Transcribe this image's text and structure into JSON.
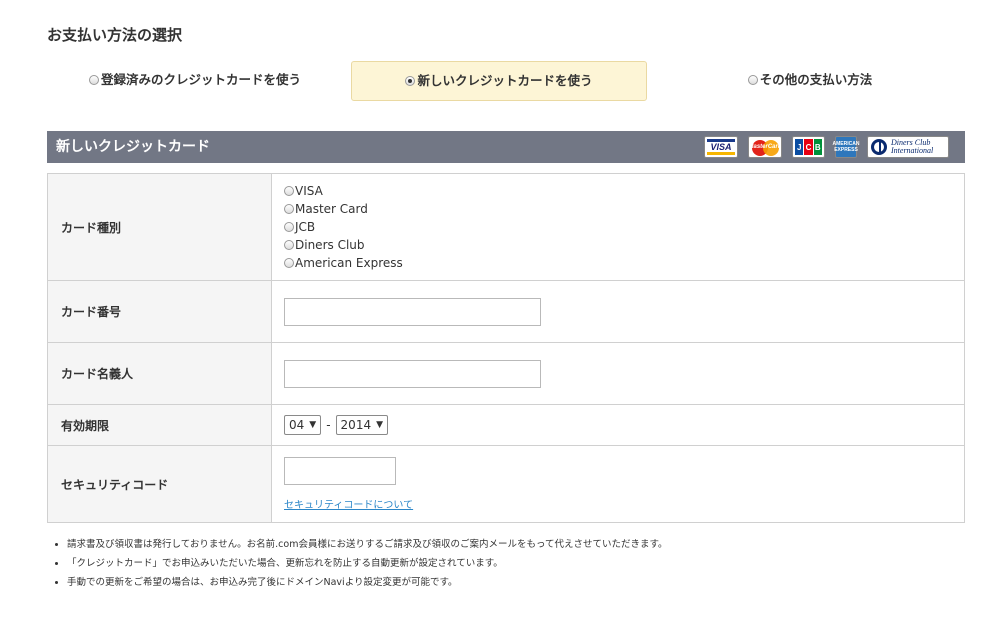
{
  "page": {
    "title": "お支払い方法の選択"
  },
  "tabs": [
    {
      "label": "登録済みのクレジットカードを使う",
      "selected": false
    },
    {
      "label": "新しいクレジットカードを使う",
      "selected": true
    },
    {
      "label": "その他の支払い方法",
      "selected": false
    }
  ],
  "section": {
    "title": "新しいクレジットカード",
    "logos": {
      "visa": "VISA",
      "mastercard": "MasterCard",
      "jcb": [
        "J",
        "C",
        "B"
      ],
      "amex": [
        "AMERICAN",
        "EXPRESS"
      ],
      "diners": [
        "Diners Club",
        "International"
      ]
    }
  },
  "form": {
    "card_type": {
      "label": "カード種別",
      "options": [
        "VISA",
        "Master Card",
        "JCB",
        "Diners Club",
        "American Express"
      ]
    },
    "card_number": {
      "label": "カード番号",
      "value": ""
    },
    "card_holder": {
      "label": "カード名義人",
      "value": ""
    },
    "expiry": {
      "label": "有効期限",
      "month": "04",
      "separator": "-",
      "year": "2014"
    },
    "security_code": {
      "label": "セキュリティコード",
      "value": "",
      "link": "セキュリティコードについて"
    }
  },
  "notes": [
    "請求書及び領収書は発行しておりません。お名前.com会員様にお送りするご請求及び領収のご案内メールをもって代えさせていただきます。",
    "「クレジットカード」でお申込みいただいた場合、更新忘れを防止する自動更新が設定されています。",
    "手動での更新をご希望の場合は、お申込み完了後にドメインNaviより設定変更が可能です。"
  ],
  "colors": {
    "header_bg": "#727785",
    "selected_tab_bg": "#fdf5d6",
    "link": "#2b86c8"
  }
}
